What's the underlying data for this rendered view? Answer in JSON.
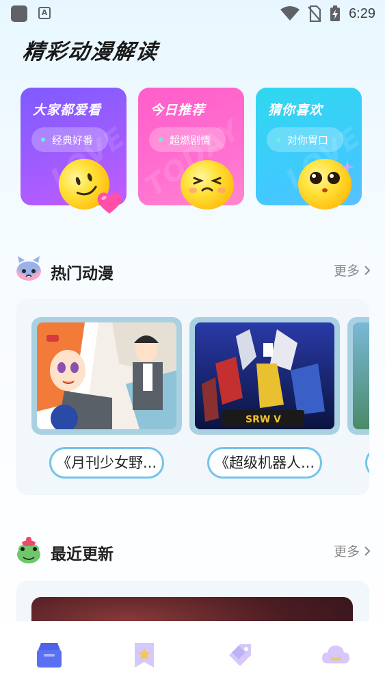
{
  "status_bar": {
    "time": "6:29",
    "a_icon_letter": "A"
  },
  "page": {
    "title": "精彩动漫解读"
  },
  "categories": [
    {
      "title": "大家都爱看",
      "tag": "经典好番",
      "watermark": "LOVE",
      "color_top": "#8a5cff",
      "color_bottom": "#b35cff"
    },
    {
      "title": "今日推荐",
      "tag": "超燃剧情",
      "watermark": "TODAY",
      "color_top": "#ff5fd6",
      "color_bottom": "#ff6ec7"
    },
    {
      "title": "猜你喜欢",
      "tag": "对你胃口",
      "watermark": "LOVE",
      "color_top": "#28d4f0",
      "color_bottom": "#48c8ff"
    }
  ],
  "hot_section": {
    "title": "热门动漫",
    "more": "更多",
    "items": [
      {
        "label": "《月刊少女野..."
      },
      {
        "label": "《超级机器人..."
      }
    ]
  },
  "recent_section": {
    "title": "最近更新",
    "more": "更多"
  },
  "bottom_nav": [
    {
      "icon": "home-box-icon",
      "active": true
    },
    {
      "icon": "bookmark-star-icon",
      "active": false
    },
    {
      "icon": "tag-icon",
      "active": false
    },
    {
      "icon": "cloud-icon",
      "active": false
    }
  ],
  "colors": {
    "accent_blue": "#74c4ec",
    "nav_active": "#5b6ff2",
    "nav_inactive": "#c9b8f7"
  }
}
